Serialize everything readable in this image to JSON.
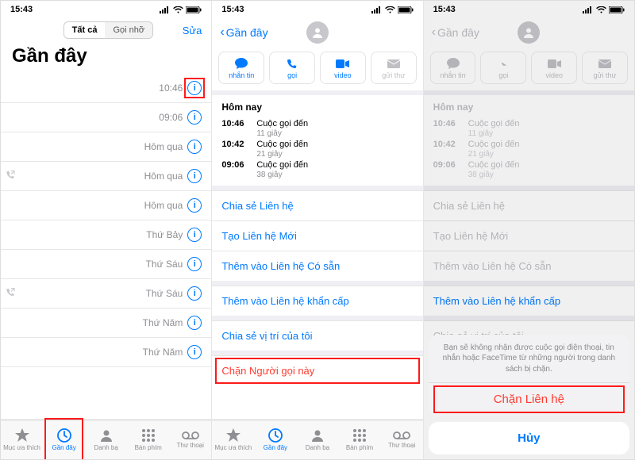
{
  "status": {
    "time": "15:43"
  },
  "pane1": {
    "seg_all": "Tất cả",
    "seg_missed": "Gọi nhỡ",
    "edit": "Sửa",
    "title": "Gần đây",
    "rows": [
      {
        "time": "10:46",
        "outgoing": false,
        "highlight_info": true
      },
      {
        "time": "09:06",
        "outgoing": false
      },
      {
        "time": "Hôm qua",
        "outgoing": false
      },
      {
        "time": "Hôm qua",
        "outgoing": true
      },
      {
        "time": "Hôm qua",
        "outgoing": false
      },
      {
        "time": "Thứ Bảy",
        "outgoing": false
      },
      {
        "time": "Thứ Sáu",
        "outgoing": false
      },
      {
        "time": "Thứ Sáu",
        "outgoing": true
      },
      {
        "time": "Thứ Năm",
        "outgoing": false
      },
      {
        "time": "Thứ Năm",
        "outgoing": false
      }
    ],
    "tabs": {
      "fav": "Mục ưa thích",
      "recent": "Gần đây",
      "contacts": "Danh bạ",
      "keypad": "Bàn phím",
      "voicemail": "Thư thoại"
    }
  },
  "detail": {
    "back": "Gần đây",
    "actions": {
      "msg": "nhắn tin",
      "call": "gọi",
      "video": "video",
      "mail": "gửi thư"
    },
    "today": "Hôm nay",
    "calls": [
      {
        "t": "10:46",
        "d": "Cuộc gọi đến",
        "s": "11 giây"
      },
      {
        "t": "10:42",
        "d": "Cuộc gọi đến",
        "s": "21 giây"
      },
      {
        "t": "09:06",
        "d": "Cuộc gọi đến",
        "s": "38 giây"
      }
    ],
    "links": {
      "share": "Chia sẻ Liên hệ",
      "newc": "Tạo Liên hệ Mới",
      "addc": "Thêm vào Liên hệ Có sẵn",
      "emerg": "Thêm vào Liên hệ khẩn cấp",
      "loc": "Chia sẻ vị trí của tôi",
      "block": "Chặn Người gọi này"
    }
  },
  "sheet": {
    "msg": "Bạn sẽ không nhận được cuộc gọi điện thoại, tin nhắn hoặc FaceTime từ những người trong danh sách bị chặn.",
    "block": "Chặn Liên hệ",
    "cancel": "Hủy"
  }
}
